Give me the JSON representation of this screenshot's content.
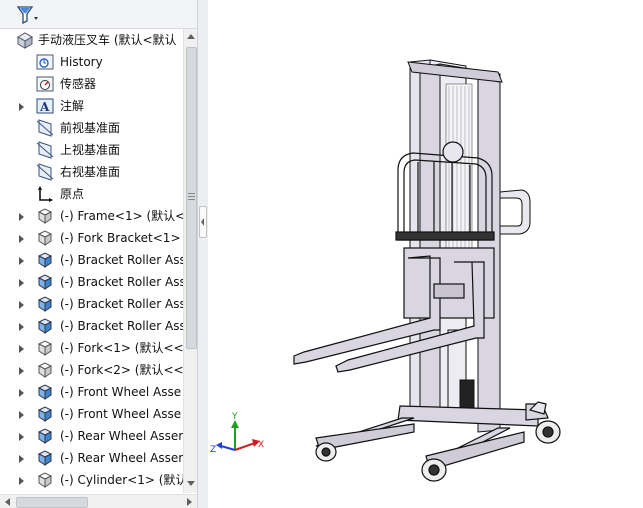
{
  "feature_tree": {
    "root": {
      "label": "手动液压叉车  (默认<默认",
      "icon": "assembly-icon"
    },
    "items": [
      {
        "label": "History",
        "icon": "history-icon",
        "expandable": false
      },
      {
        "label": "传感器",
        "icon": "sensor-icon",
        "expandable": false
      },
      {
        "label": "注解",
        "icon": "annotation-icon",
        "expandable": true
      },
      {
        "label": "前视基准面",
        "icon": "plane-icon",
        "expandable": false
      },
      {
        "label": "上视基准面",
        "icon": "plane-icon",
        "expandable": false
      },
      {
        "label": "右视基准面",
        "icon": "plane-icon",
        "expandable": false
      },
      {
        "label": "原点",
        "icon": "origin-icon",
        "expandable": false
      },
      {
        "label": "(-) Frame<1> (默认<",
        "icon": "part-icon",
        "expandable": true
      },
      {
        "label": "(-) Fork Bracket<1>",
        "icon": "part-icon",
        "expandable": true
      },
      {
        "label": "(-) Bracket Roller Ass",
        "icon": "subassembly-icon",
        "expandable": true
      },
      {
        "label": "(-) Bracket Roller Ass",
        "icon": "subassembly-icon",
        "expandable": true
      },
      {
        "label": "(-) Bracket Roller Ass",
        "icon": "subassembly-icon",
        "expandable": true
      },
      {
        "label": "(-) Bracket Roller Ass",
        "icon": "subassembly-icon",
        "expandable": true
      },
      {
        "label": "(-) Fork<1> (默认<<",
        "icon": "part-icon",
        "expandable": true
      },
      {
        "label": "(-) Fork<2> (默认<<",
        "icon": "part-icon",
        "expandable": true
      },
      {
        "label": "(-) Front Wheel Asse",
        "icon": "subassembly-icon",
        "expandable": true
      },
      {
        "label": "(-) Front Wheel Asse",
        "icon": "subassembly-icon",
        "expandable": true
      },
      {
        "label": "(-) Rear Wheel Asser",
        "icon": "subassembly-icon",
        "expandable": true
      },
      {
        "label": "(-) Rear Wheel Asser",
        "icon": "subassembly-icon",
        "expandable": true
      },
      {
        "label": "(-) Cylinder<1> (默认",
        "icon": "part-icon",
        "expandable": true
      }
    ]
  },
  "triad": {
    "x": "X",
    "y": "Y",
    "z": "Z"
  },
  "colors": {
    "selection": "#1e6fd8",
    "panel_bg": "#f3f4f6",
    "frame": "#d9d6e1",
    "x_axis": "#cc2020",
    "y_axis": "#20a020",
    "z_axis": "#2040d0"
  }
}
